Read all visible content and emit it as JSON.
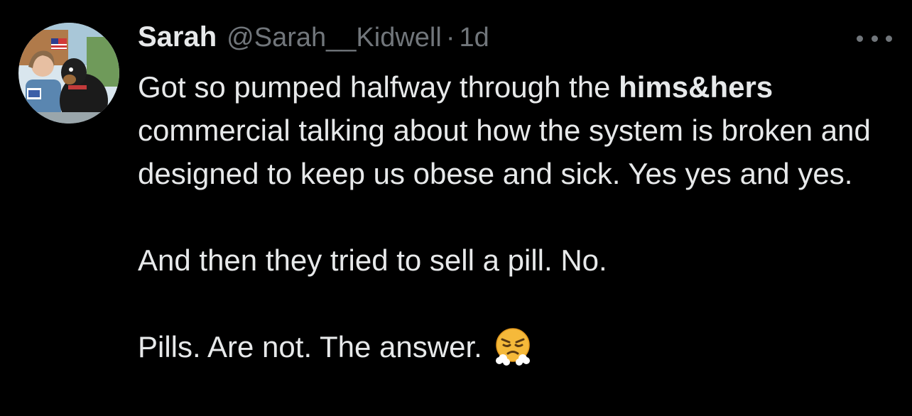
{
  "author": {
    "name": "Sarah",
    "handle": "@Sarah__Kidwell",
    "separator": "·",
    "timestamp": "1d",
    "avatar_icon": "profile-avatar"
  },
  "menu": {
    "icon": "more-horizontal-icon"
  },
  "tweet": {
    "line1_prefix": "Got so pumped halfway through the ",
    "line1_mention": "hims&hers",
    "line1_rest": " commercial talking about how the system is broken and designed to keep us obese and sick. Yes yes and yes.",
    "paragraph2": "And then they tried to sell a pill. No.",
    "paragraph3": "Pills. Are not. The answer.",
    "emoji": "face-with-steam-from-nose"
  },
  "colors": {
    "background": "#000000",
    "primary_text": "#e7e9ea",
    "secondary_text": "#71767b"
  }
}
